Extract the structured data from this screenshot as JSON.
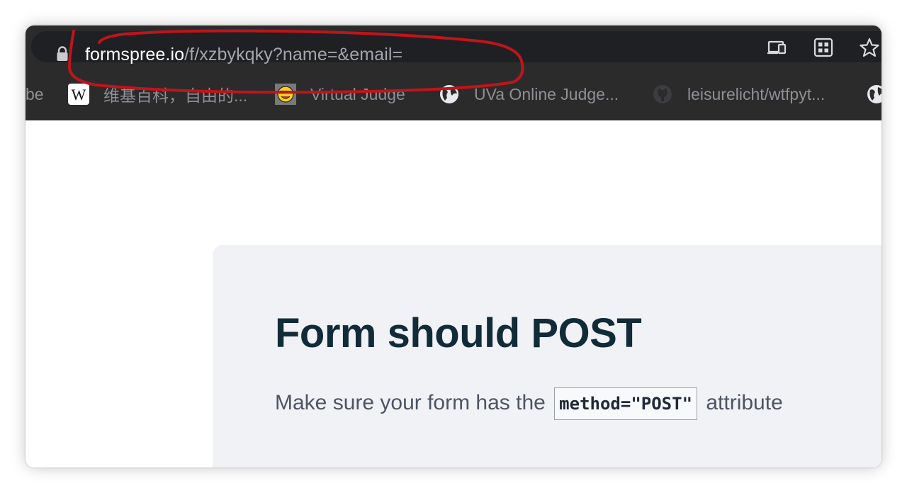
{
  "address_bar": {
    "host": "formspree.io",
    "path": "/f/xzbykqky?name=&email="
  },
  "toolbar_icons": [
    "cast-icon",
    "extensions-grid-icon",
    "bookmark-star-icon"
  ],
  "bookmarks": [
    {
      "label": "be",
      "icon": "partial"
    },
    {
      "label": "维基百科，自由的...",
      "icon": "wikipedia-icon"
    },
    {
      "label": "Virtual Judge",
      "icon": "smiley-icon"
    },
    {
      "label": "UVa Online Judge...",
      "icon": "globe-icon"
    },
    {
      "label": "leisurelicht/wtfpyt...",
      "icon": "github-icon"
    },
    {
      "label": "",
      "icon": "globe-icon"
    }
  ],
  "page": {
    "title": "Form should POST",
    "text_before": "Make sure your form has the ",
    "code": "method=\"POST\"",
    "text_after": " attribute"
  },
  "colors": {
    "toolbar_bg": "#2b2b2b",
    "omnibox_bg": "#1f2023",
    "card_bg": "#f1f2f5",
    "title_color": "#112b38",
    "annotation_red": "#c0141c"
  }
}
